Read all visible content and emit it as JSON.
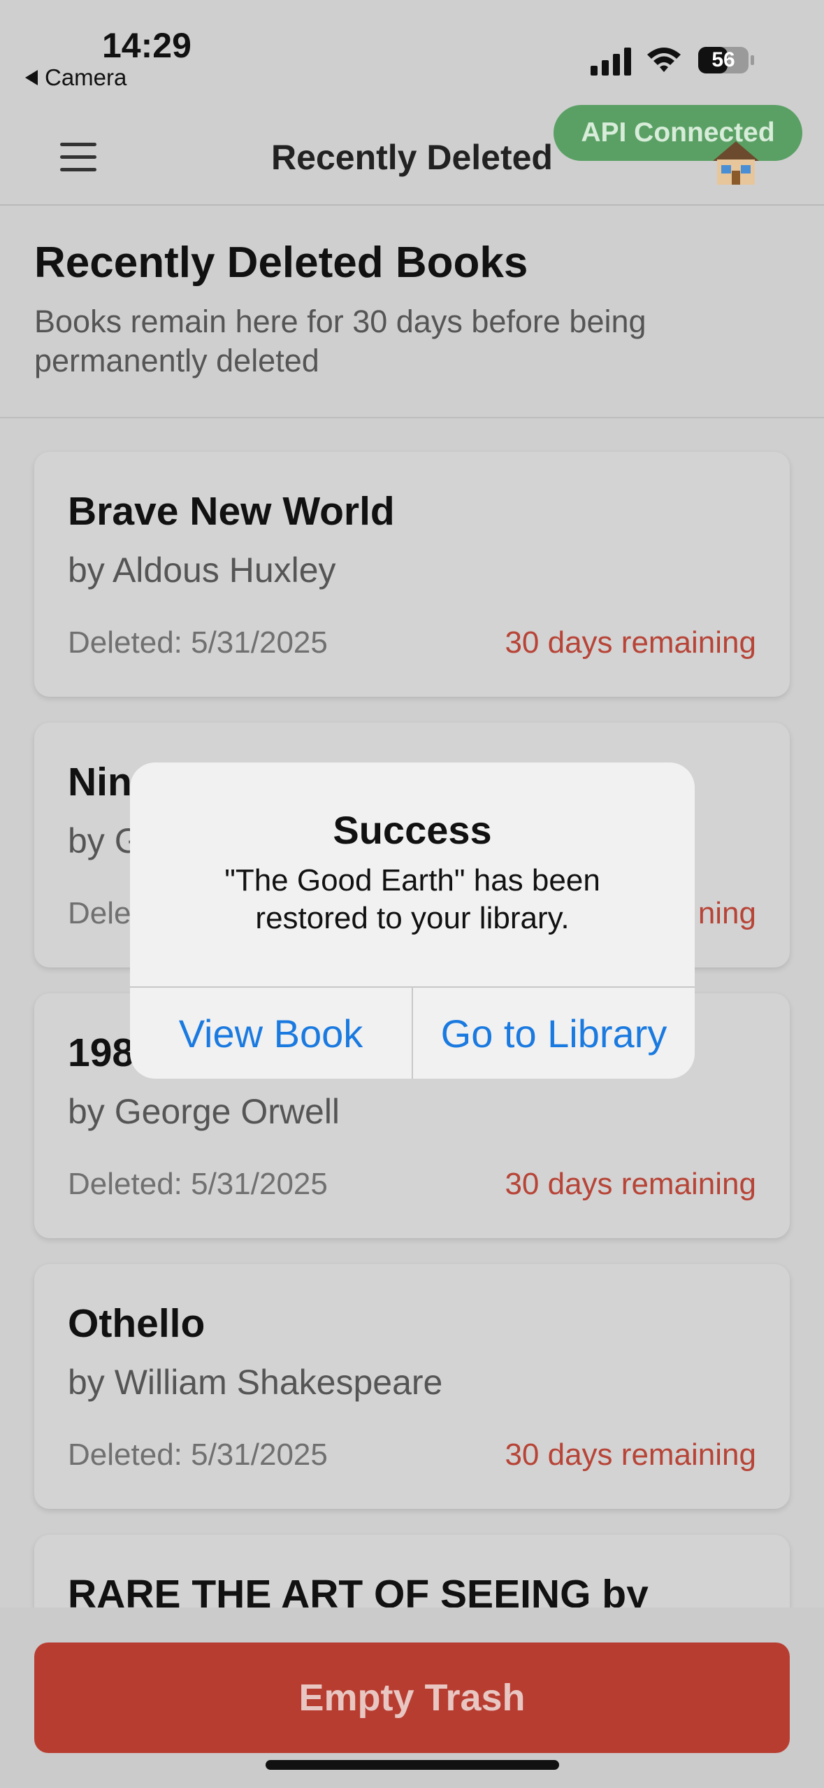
{
  "status_bar": {
    "time": "14:29",
    "back_label": "Camera",
    "battery": "56"
  },
  "header": {
    "title": "Recently Deleted",
    "api_badge": "API Connected"
  },
  "section": {
    "title": "Recently Deleted Books",
    "subtitle": "Books remain here for 30 days before being permanently deleted"
  },
  "books": [
    {
      "title": "Brave New World",
      "author": "by Aldous Huxley",
      "deleted": "Deleted: 5/31/2025",
      "remaining": "30 days remaining"
    },
    {
      "title": "Nin",
      "author": "by G",
      "deleted": "Dele",
      "remaining": "ning"
    },
    {
      "title": "198",
      "author": "by George Orwell",
      "deleted": "Deleted: 5/31/2025",
      "remaining": "30 days remaining"
    },
    {
      "title": "Othello",
      "author": "by William Shakespeare",
      "deleted": "Deleted: 5/31/2025",
      "remaining": "30 days remaining"
    },
    {
      "title": "RARE THE ART OF SEEING by",
      "author": "",
      "deleted": "",
      "remaining": ""
    }
  ],
  "footer": {
    "empty_trash": "Empty Trash"
  },
  "alert": {
    "title": "Success",
    "message": "\"The Good Earth\" has been restored to your library.",
    "view_book": "View Book",
    "go_to_library": "Go to Library"
  },
  "colors": {
    "accent_blue": "#1a7ae0",
    "danger_red": "#b83d31",
    "remaining_red": "#b74437",
    "badge_green": "#5aa064"
  }
}
